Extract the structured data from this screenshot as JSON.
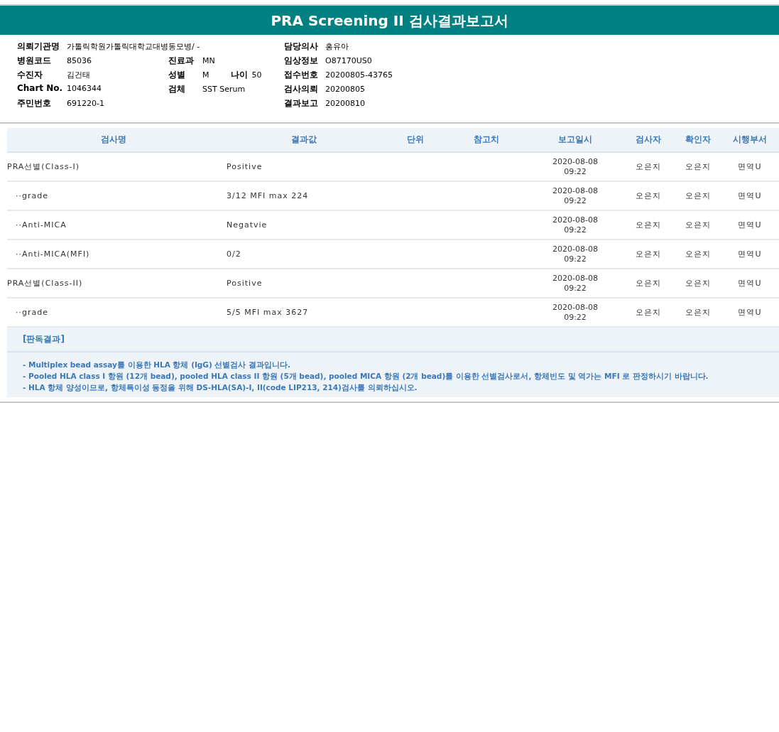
{
  "title": "PRA Screening II 검사결과보고서",
  "info": [
    {
      "left": {
        "label": "의뢰기관명",
        "value": "가톨릭학원가톨릭대학교대병동모병/ -"
      },
      "right": {
        "label": "담당의사",
        "value": "홍유아"
      }
    },
    {
      "left": {
        "label": "병원코드",
        "value": "85036"
      },
      "middle": [
        {
          "label": "진료과",
          "value": "MN"
        }
      ],
      "right": {
        "label": "임상정보",
        "value": "O87170US0"
      }
    },
    {
      "left": {
        "label": "수진자",
        "value": "김건태"
      },
      "middle": [
        {
          "label": "성별",
          "value": "M"
        },
        {
          "label": "나이",
          "value": "50"
        }
      ],
      "right": {
        "label": "접수번호",
        "value": "20200805-43765"
      }
    },
    {
      "left": {
        "label": "Chart No.",
        "value": "1046344"
      },
      "middle": [
        {
          "label": "검체",
          "value": "SST Serum"
        }
      ],
      "right": {
        "label": "검사의뢰",
        "value": "20200805"
      }
    },
    {
      "left": {
        "label": "주민번호",
        "value": "691220-1"
      },
      "right": {
        "label": "결과보고",
        "value": "20200810"
      }
    }
  ],
  "table": {
    "columns": [
      "검사명",
      "결과값",
      "단위",
      "참고치",
      "보고일시",
      "검사자",
      "확인자",
      "시행부서"
    ],
    "rows": [
      {
        "name": "PRA선별(Class-I)",
        "result": "Positive",
        "date": "2020-08-08",
        "time": "09:22",
        "tester": "오은지",
        "checker": "오은지",
        "dept": "면역U",
        "children": [
          {
            "name": "··grade",
            "result": "3/12 MFI max 224",
            "date": "2020-08-08",
            "time": "09:22",
            "tester": "오은지",
            "checker": "오은지",
            "dept": "면역U"
          },
          {
            "name": "··Anti-MICA",
            "result": "Negatvie",
            "date": "2020-08-08",
            "time": "09:22",
            "tester": "오은지",
            "checker": "오은지",
            "dept": "면역U"
          },
          {
            "name": "··Anti-MICA(MFI)",
            "result": "0/2",
            "date": "2020-08-08",
            "time": "09:22",
            "tester": "오은지",
            "checker": "오은지",
            "dept": "면역U"
          }
        ]
      },
      {
        "name": "PRA선별(Class-II)",
        "result": "Positive",
        "date": "2020-08-08",
        "time": "09:22",
        "tester": "오은지",
        "checker": "오은지",
        "dept": "면역U",
        "children": [
          {
            "name": "··grade",
            "result": "5/5 MFI max 3627",
            "date": "2020-08-08",
            "time": "09:22",
            "tester": "오은지",
            "checker": "오은지",
            "dept": "면역U"
          }
        ]
      }
    ]
  },
  "interpretation": {
    "heading": "[판독결과]",
    "lines": [
      "- Multiplex bead assay를 이용한 HLA 항체 (IgG) 선별검사 결과입니다.",
      "- Pooled HLA class I 항원 (12개 bead), pooled HLA class II 항원 (5개 bead), pooled MICA 항원 (2개 bead)를 이용한 선별검사로서, 항체빈도 및 역가는 MFI 로 판정하시기 바랍니다.",
      "- HLA 항체 양성이므로, 항체특이성 동정을 위해 DS-HLA(SA)-I, II(code LIP213, 214)검사를 의뢰하십시오."
    ]
  }
}
